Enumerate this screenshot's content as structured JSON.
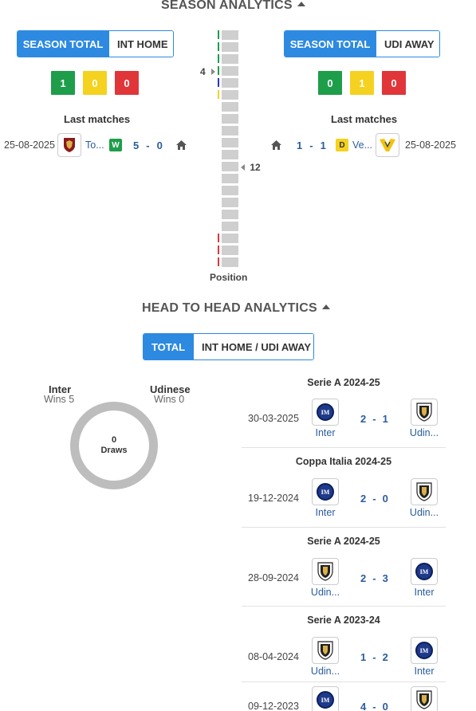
{
  "season": {
    "title": "SEASON ANALYTICS",
    "home": {
      "toggle_active": "SEASON TOTAL",
      "toggle_other": "INT HOME",
      "form": [
        "1",
        "0",
        "0"
      ],
      "last_matches_label": "Last matches",
      "last_match": {
        "date": "25-08-2025",
        "opponent": "To...",
        "result": "W",
        "score_home": "5",
        "score_away": "0"
      }
    },
    "away": {
      "toggle_active": "SEASON TOTAL",
      "toggle_other": "UDI AWAY",
      "form": [
        "0",
        "1",
        "0"
      ],
      "last_matches_label": "Last matches",
      "last_match": {
        "date": "25-08-2025",
        "opponent": "Ve...",
        "result": "D",
        "score_home": "1",
        "score_away": "1"
      }
    },
    "ladder": {
      "left_marker": "4",
      "right_marker": "12",
      "label": "Position"
    }
  },
  "h2h": {
    "title": "HEAD TO HEAD ANALYTICS",
    "toggle_active": "TOTAL",
    "toggle_other": "INT HOME / UDI AWAY",
    "left_team": "Inter",
    "left_wins": "Wins 5",
    "right_team": "Udinese",
    "right_wins": "Wins 0",
    "draws_count": "0",
    "draws_label": "Draws",
    "matches": [
      {
        "competition": "Serie A 2024-25",
        "date": "30-03-2025",
        "home": "Inter",
        "home_logo": "inter",
        "score_home": "2",
        "score_away": "1",
        "away": "Udin...",
        "away_logo": "udinese"
      },
      {
        "competition": "Coppa Italia 2024-25",
        "date": "19-12-2024",
        "home": "Inter",
        "home_logo": "inter",
        "score_home": "2",
        "score_away": "0",
        "away": "Udin...",
        "away_logo": "udinese"
      },
      {
        "competition": "Serie A 2024-25",
        "date": "28-09-2024",
        "home": "Udin...",
        "home_logo": "udinese",
        "score_home": "2",
        "score_away": "3",
        "away": "Inter",
        "away_logo": "inter"
      },
      {
        "competition": "Serie A 2023-24",
        "date": "08-04-2024",
        "home": "Udin...",
        "home_logo": "udinese",
        "score_home": "1",
        "score_away": "2",
        "away": "Inter",
        "away_logo": "inter"
      },
      {
        "competition": "",
        "date": "09-12-2023",
        "home": "",
        "home_logo": "inter",
        "score_home": "4",
        "score_away": "0",
        "away": "",
        "away_logo": "udinese"
      }
    ]
  },
  "colors": {
    "accent": "#2d8ae0",
    "win": "#1e9e4a",
    "draw": "#f4d21f",
    "loss": "#e0363a",
    "score": "#2a5d9f"
  },
  "icons": [
    "caret-up-icon",
    "home-icon",
    "torino-logo",
    "verona-logo",
    "inter-logo",
    "udinese-logo"
  ]
}
